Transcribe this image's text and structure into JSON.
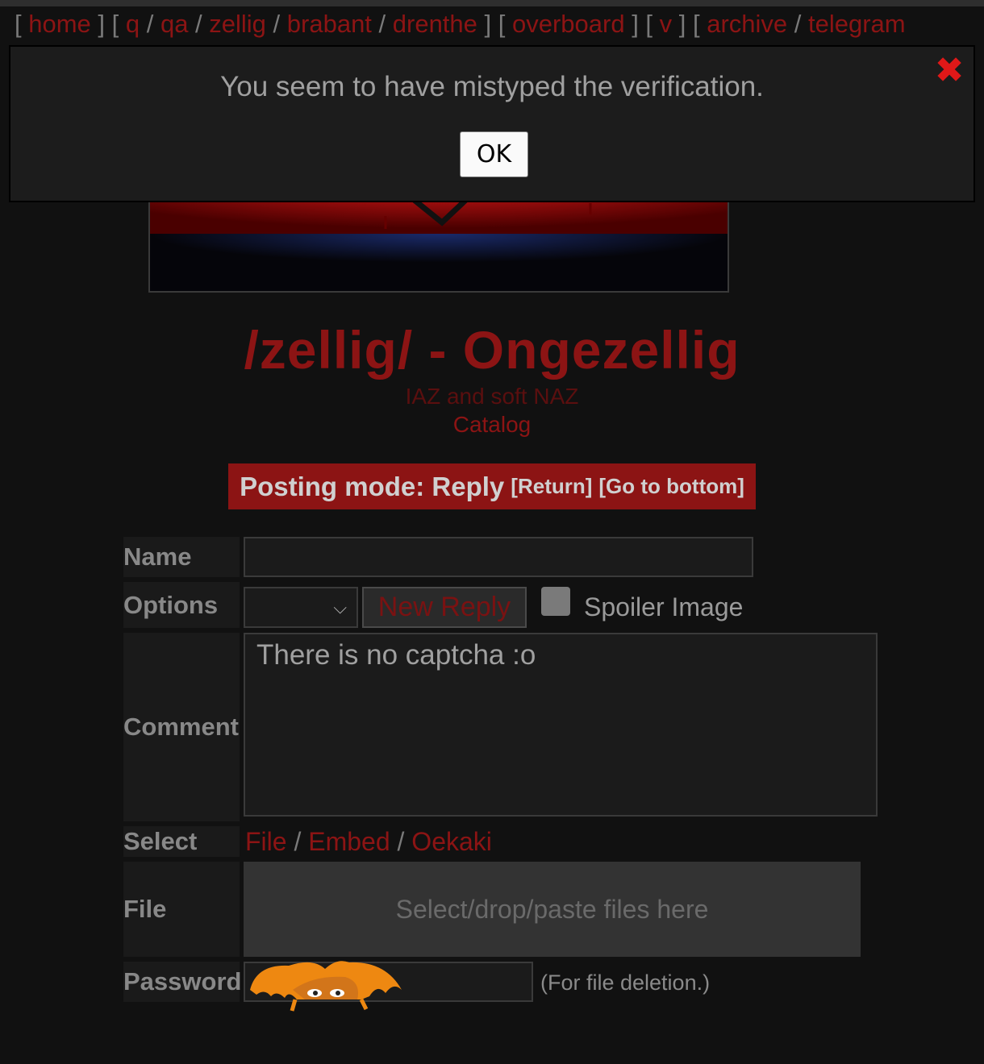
{
  "nav": {
    "g1": [
      "home"
    ],
    "g2": [
      "q",
      "qa",
      "zellig",
      "brabant",
      "drenthe"
    ],
    "g3": [
      "overboard"
    ],
    "g4": [
      "v"
    ],
    "g5": [
      "archive",
      "telegram"
    ]
  },
  "alert": {
    "message": "You seem to have mistyped the verification.",
    "ok_label": "OK"
  },
  "board": {
    "title": "/zellig/ - Ongezellig",
    "subtitle": "IAZ and soft NAZ",
    "catalog_link": "Catalog"
  },
  "posting_mode": {
    "label": "Posting mode: Reply",
    "return_link": "[Return]",
    "bottom_link": "[Go to bottom]"
  },
  "form": {
    "name_label": "Name",
    "options_label": "Options",
    "new_reply_label": "New Reply",
    "spoiler_label": "Spoiler Image",
    "comment_label": "Comment",
    "comment_value": "There is no captcha :o",
    "select_label": "Select",
    "select_file": "File",
    "select_embed": "Embed",
    "select_oekaki": "Oekaki",
    "file_label": "File",
    "dropzone_text": "Select/drop/paste files here",
    "password_label": "Password",
    "password_hint": "(For file deletion.)"
  },
  "colors": {
    "accent": "#8c1414",
    "close": "#e01818",
    "background": "#111111"
  }
}
